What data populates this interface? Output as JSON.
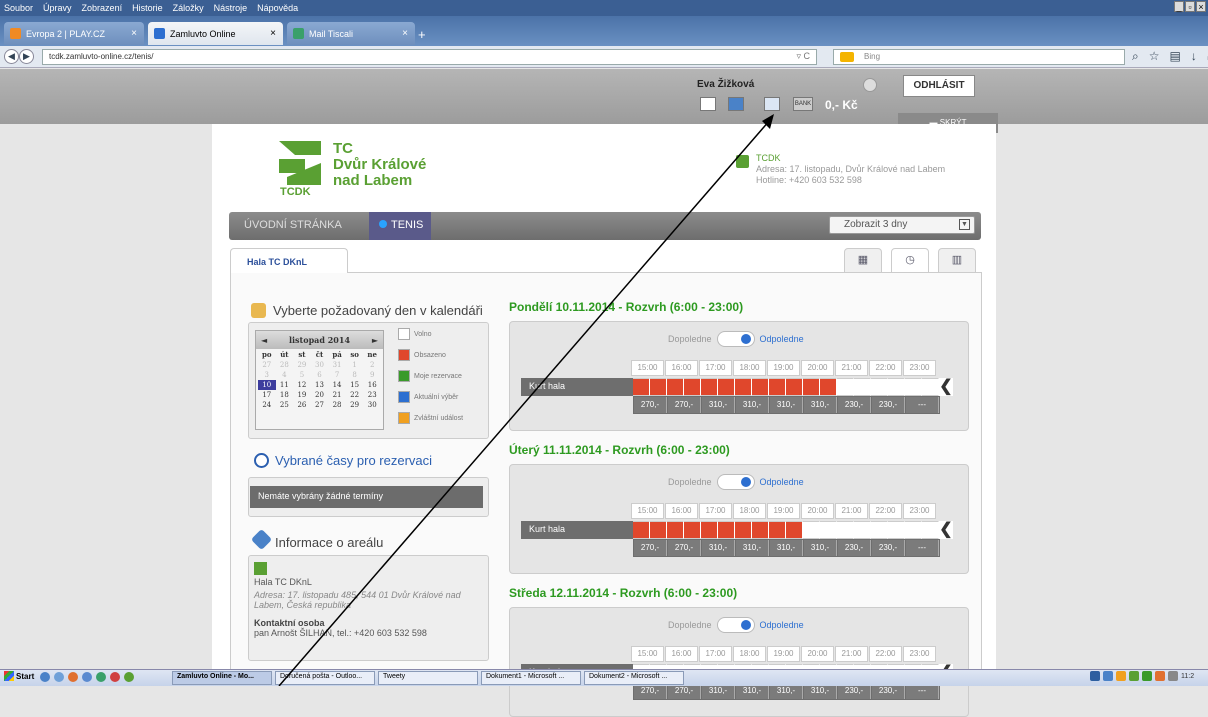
{
  "browser": {
    "menu": [
      "Soubor",
      "Úpravy",
      "Zobrazení",
      "Historie",
      "Záložky",
      "Nástroje",
      "Nápověda"
    ],
    "tabs": [
      {
        "label": "Evropa 2 | PLAY.CZ",
        "close": "×"
      },
      {
        "label": "Zamluvto Online",
        "close": "×"
      },
      {
        "label": "Mail Tiscali",
        "close": "×"
      }
    ],
    "newtab": "+",
    "url": "tcdk.zamluvto-online.cz/tenis/",
    "search_placeholder": "Bing"
  },
  "userbar": {
    "name": "Eva Žižková",
    "logout": "ODHLÁSIT",
    "credit": "0,- Kč",
    "hide": "SKRÝT",
    "bank_label": "BANK"
  },
  "club": {
    "logo_lines": [
      "TC",
      "Dvůr Králové",
      "nad Labem"
    ],
    "logo_abbr": "TCDK",
    "name": "TCDK",
    "address": "Adresa: 17. listopadu, Dvůr Králové nad Labem",
    "hotline": "Hotline: +420 603 532 598"
  },
  "nav": {
    "home": "ÚVODNÍ STRÁNKA",
    "tenis": "TENIS",
    "days_select": "Zobrazit 3 dny"
  },
  "tab_hala": "Hala TC DKnL",
  "calendar": {
    "title": "Vyberte požadovaný den v kalendáři",
    "month": "listopad 2014",
    "dayheads": [
      "po",
      "út",
      "st",
      "čt",
      "pá",
      "so",
      "ne"
    ],
    "rows": [
      [
        "27",
        "28",
        "29",
        "30",
        "31",
        "1",
        "2"
      ],
      [
        "3",
        "4",
        "5",
        "6",
        "7",
        "8",
        "9"
      ],
      [
        "10",
        "11",
        "12",
        "13",
        "14",
        "15",
        "16"
      ],
      [
        "17",
        "18",
        "19",
        "20",
        "21",
        "22",
        "23"
      ],
      [
        "24",
        "25",
        "26",
        "27",
        "28",
        "29",
        "30"
      ]
    ],
    "legend": [
      {
        "label": "Volno",
        "color": "#ffffff"
      },
      {
        "label": "Obsazeno",
        "color": "#e0472c"
      },
      {
        "label": "Moje rezervace",
        "color": "#3a9a2a"
      },
      {
        "label": "Aktuální výběr",
        "color": "#2d6fd0"
      },
      {
        "label": "Zvláštní událost",
        "color": "#f0a020"
      }
    ]
  },
  "selected": {
    "title": "Vybrané časy pro rezervaci",
    "empty": "Nemáte vybrány žádné termíny"
  },
  "info": {
    "title": "Informace o areálu",
    "name": "Hala TC DKnL",
    "address": "Adresa: 17. listopadu 485, 544 01 Dvůr Králové nad Labem, Česká republika",
    "contact_label": "Kontaktní osoba",
    "contact": "pan Arnošt ŠILHAN, tel.: +420 603 532 598"
  },
  "schedule": {
    "toggle_off": "Dopoledne",
    "toggle_on": "Odpoledne",
    "hours": [
      "15:00",
      "16:00",
      "17:00",
      "18:00",
      "19:00",
      "20:00",
      "21:00",
      "22:00",
      "23:00"
    ],
    "court": "Kurt hala",
    "prices": [
      "270,-",
      "270,-",
      "310,-",
      "310,-",
      "310,-",
      "310,-",
      "230,-",
      "230,-",
      "---"
    ],
    "days": [
      {
        "title": "Pondělí 10.11.2014 - Rozvrh (6:00 - 23:00)",
        "booked_slots": 12
      },
      {
        "title": "Úterý 11.11.2014 - Rozvrh (6:00 - 23:00)",
        "booked_slots": 10
      },
      {
        "title": "Středa 12.11.2014 - Rozvrh (6:00 - 23:00)",
        "booked_slots": 0
      }
    ]
  },
  "taskbar": {
    "start": "Start",
    "items": [
      "Zamluvto Online - Mo...",
      "Doručená pošta - Outloo...",
      "Tweety",
      "Dokument1 - Microsoft ...",
      "Dokument2 - Microsoft ..."
    ],
    "clock": "11:2"
  }
}
